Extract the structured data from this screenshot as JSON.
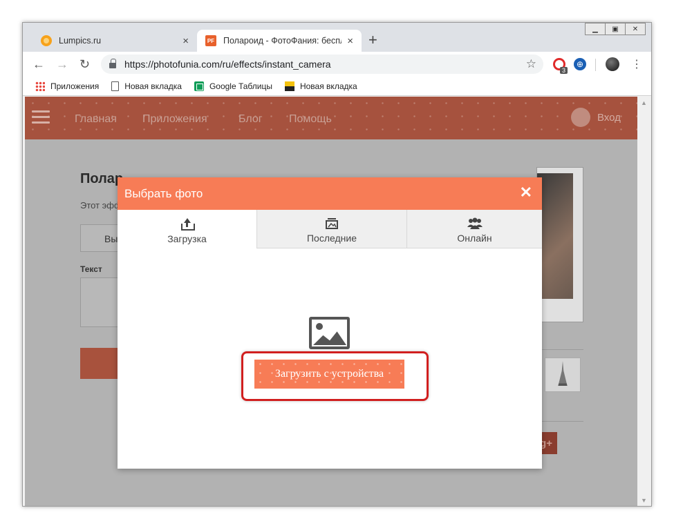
{
  "browser": {
    "tabs": [
      {
        "title": "Lumpics.ru",
        "favicon": "lumpics-favicon",
        "close": "×"
      },
      {
        "title": "Полароид - ФотоФания: беспла",
        "favicon": "photofunia-favicon",
        "close": "×"
      }
    ],
    "new_tab": "+",
    "favicon_pf_text": "PF",
    "url": "https://photofunia.com/ru/effects/instant_camera",
    "ext_badge": "3",
    "bookmarks": [
      {
        "label": "Приложения",
        "icon": "apps-grid-icon"
      },
      {
        "label": "Новая вкладка",
        "icon": "document-icon"
      },
      {
        "label": "Google Таблицы",
        "icon": "sheets-icon"
      },
      {
        "label": "Новая вкладка",
        "icon": "image-icon"
      }
    ]
  },
  "site": {
    "nav": [
      "Главная",
      "Приложения",
      "Блог",
      "Помощь"
    ],
    "login": "Вход",
    "bg_title": "Полар",
    "bg_desc": "Этот эфф",
    "bg_btn": "Вы",
    "bg_label": "Текст"
  },
  "modal": {
    "title": "Выбрать фото",
    "close": "✕",
    "tabs": [
      {
        "label": "Загрузка",
        "icon": "upload-icon",
        "active": true
      },
      {
        "label": "Последние",
        "icon": "recent-photos-icon",
        "active": false
      },
      {
        "label": "Онлайн",
        "icon": "users-icon",
        "active": false
      }
    ],
    "upload_button": "Загрузить с устройства"
  },
  "colors": {
    "accent": "#f77c56",
    "highlight": "#d11f1f",
    "header_dim": "#a6523e"
  }
}
